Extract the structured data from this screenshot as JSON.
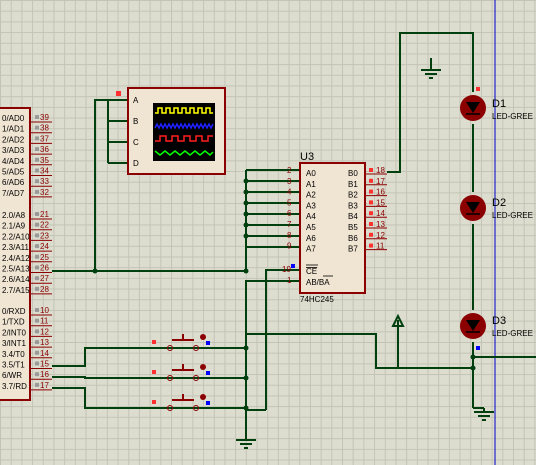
{
  "mcu": {
    "port0_labels": [
      "0/AD0",
      "1/AD1",
      "2/AD2",
      "3/AD3",
      "4/AD4",
      "5/AD5",
      "6/AD6",
      "7/AD7"
    ],
    "port0_pins": [
      "39",
      "38",
      "37",
      "36",
      "35",
      "34",
      "33",
      "32"
    ],
    "port2_labels": [
      "2.0/A8",
      "2.1/A9",
      "2.2/A10",
      "2.3/A11",
      "2.4/A12",
      "2.5/A13",
      "2.6/A14",
      "2.7/A15"
    ],
    "port2_pins": [
      "21",
      "22",
      "23",
      "24",
      "25",
      "26",
      "27",
      "28"
    ],
    "port3_labels": [
      "0/RXD",
      "1/TXD",
      "2/INT0",
      "3/INT1",
      "3.4/T0",
      "3.5/T1",
      "6/WR",
      "3.7/RD"
    ],
    "port3_pins": [
      "10",
      "11",
      "12",
      "13",
      "14",
      "15",
      "16",
      "17"
    ]
  },
  "oscilloscope": {
    "channels": [
      "A",
      "B",
      "C",
      "D"
    ]
  },
  "ic": {
    "ref": "U3",
    "part": "74HC245",
    "a_labels": [
      "A0",
      "A1",
      "A2",
      "A3",
      "A4",
      "A5",
      "A6",
      "A7"
    ],
    "a_pins": [
      "2",
      "3",
      "4",
      "5",
      "6",
      "7",
      "8",
      "9"
    ],
    "b_labels": [
      "B0",
      "B1",
      "B2",
      "B3",
      "B4",
      "B5",
      "B6",
      "B7"
    ],
    "b_pins": [
      "18",
      "17",
      "16",
      "15",
      "14",
      "13",
      "12",
      "11"
    ],
    "ce_label": "CE",
    "dir_label": "AB/BA",
    "ce_pin": "19",
    "dir_pin": "1"
  },
  "leds": [
    {
      "ref": "D1",
      "part": "LED-GREE"
    },
    {
      "ref": "D2",
      "part": "LED-GREE"
    },
    {
      "ref": "D3",
      "part": "LED-GREE"
    }
  ],
  "colors": {
    "wire": "#00400f",
    "component_fill": "#f0e4d2",
    "component_border": "#8b0000",
    "pin_label": "#8b0000",
    "led_fill": "#8b0000",
    "probe_blue": "#0000ff",
    "scope_trace_1": "#ffff00",
    "scope_trace_2": "#2020ff",
    "scope_trace_3": "#ff2020",
    "scope_trace_4": "#00ff00"
  }
}
